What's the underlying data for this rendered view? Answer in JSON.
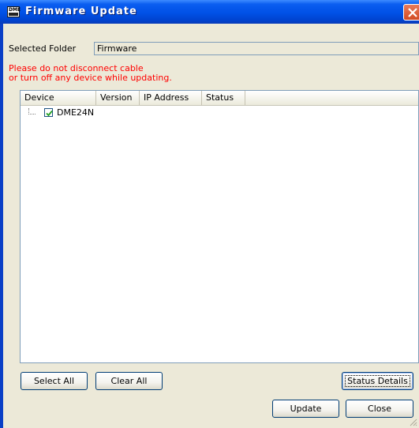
{
  "window": {
    "title": "Firmware Update",
    "app_icon_label": "DME"
  },
  "folder": {
    "label": "Selected Folder",
    "value": "Firmware"
  },
  "warning": {
    "line1": "Please do not disconnect cable",
    "line2": "or turn off any device while updating."
  },
  "table": {
    "columns": [
      "Device",
      "Version",
      "IP Address",
      "Status"
    ],
    "rows": [
      {
        "device": "DME24N",
        "checked": true,
        "version": "",
        "ip": "",
        "status": ""
      }
    ]
  },
  "buttons": {
    "select_all": "Select All",
    "clear_all": "Clear All",
    "status_details": "Status Details",
    "update": "Update",
    "close": "Close"
  },
  "colors": {
    "titlebar": "#0054e3",
    "warning_text": "#ff0000",
    "dialog_bg": "#ece9d8"
  }
}
